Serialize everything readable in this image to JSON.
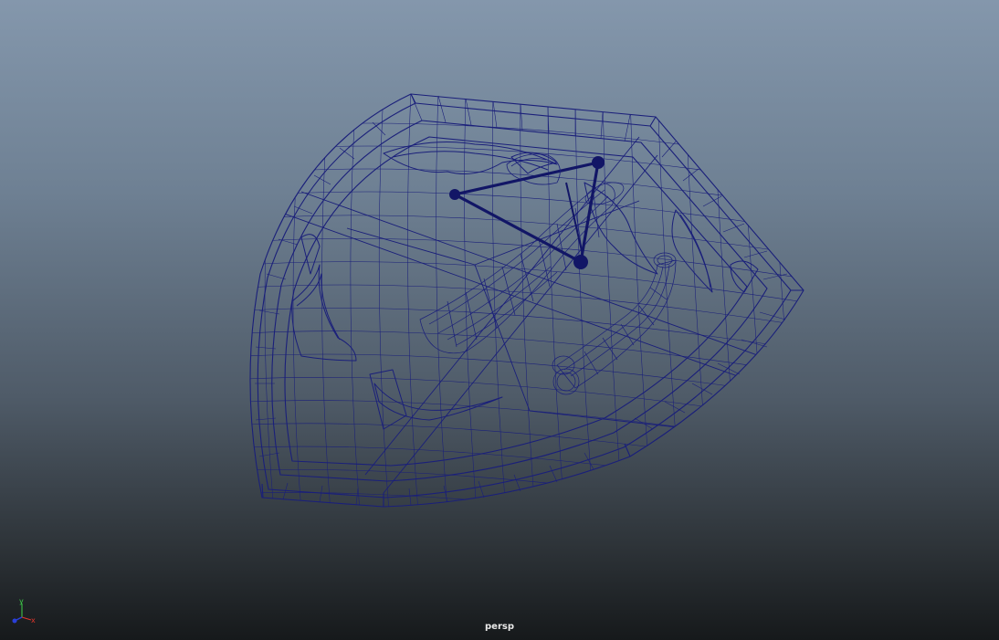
{
  "viewport": {
    "camera_name": "persp",
    "display_mode": "wireframe",
    "background_top": "#8497ac",
    "background_bottom": "#16191b",
    "wireframe_color": "#1a1f7a"
  },
  "object": {
    "description_icon": "shield-mesh"
  },
  "axis": {
    "y_label": "y",
    "x_label": "x",
    "z_label": "",
    "y_color": "#3fd24a",
    "x_color": "#e0352b",
    "z_color": "#2a3fd8"
  }
}
